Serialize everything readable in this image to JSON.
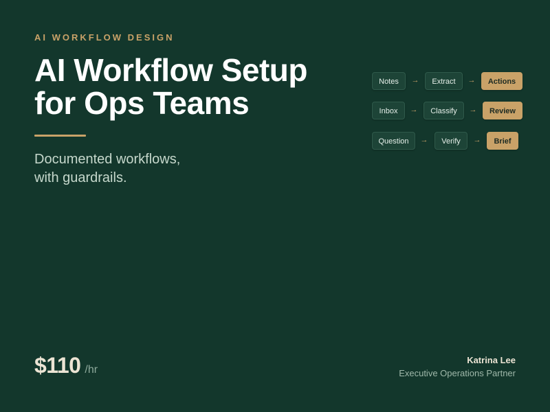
{
  "header": {
    "eyebrow": "AI WORKFLOW DESIGN",
    "title_line1": "AI Workflow Setup",
    "title_line2": "for Ops Teams",
    "subtitle_line1": "Documented workflows,",
    "subtitle_line2": "with guardrails."
  },
  "workflows": [
    {
      "steps": [
        "Notes",
        "Extract",
        "Actions"
      ]
    },
    {
      "steps": [
        "Inbox",
        "Classify",
        "Review"
      ]
    },
    {
      "steps": [
        "Question",
        "Verify",
        "Brief"
      ]
    }
  ],
  "arrow_glyph": "→",
  "pricing": {
    "amount": "$110",
    "unit": "/hr"
  },
  "person": {
    "name": "Katrina Lee",
    "role": "Executive Operations Partner"
  },
  "colors": {
    "background": "#13372c",
    "accent": "#c9a268",
    "chip": "#1d4437",
    "text_light": "#ece4d4"
  }
}
